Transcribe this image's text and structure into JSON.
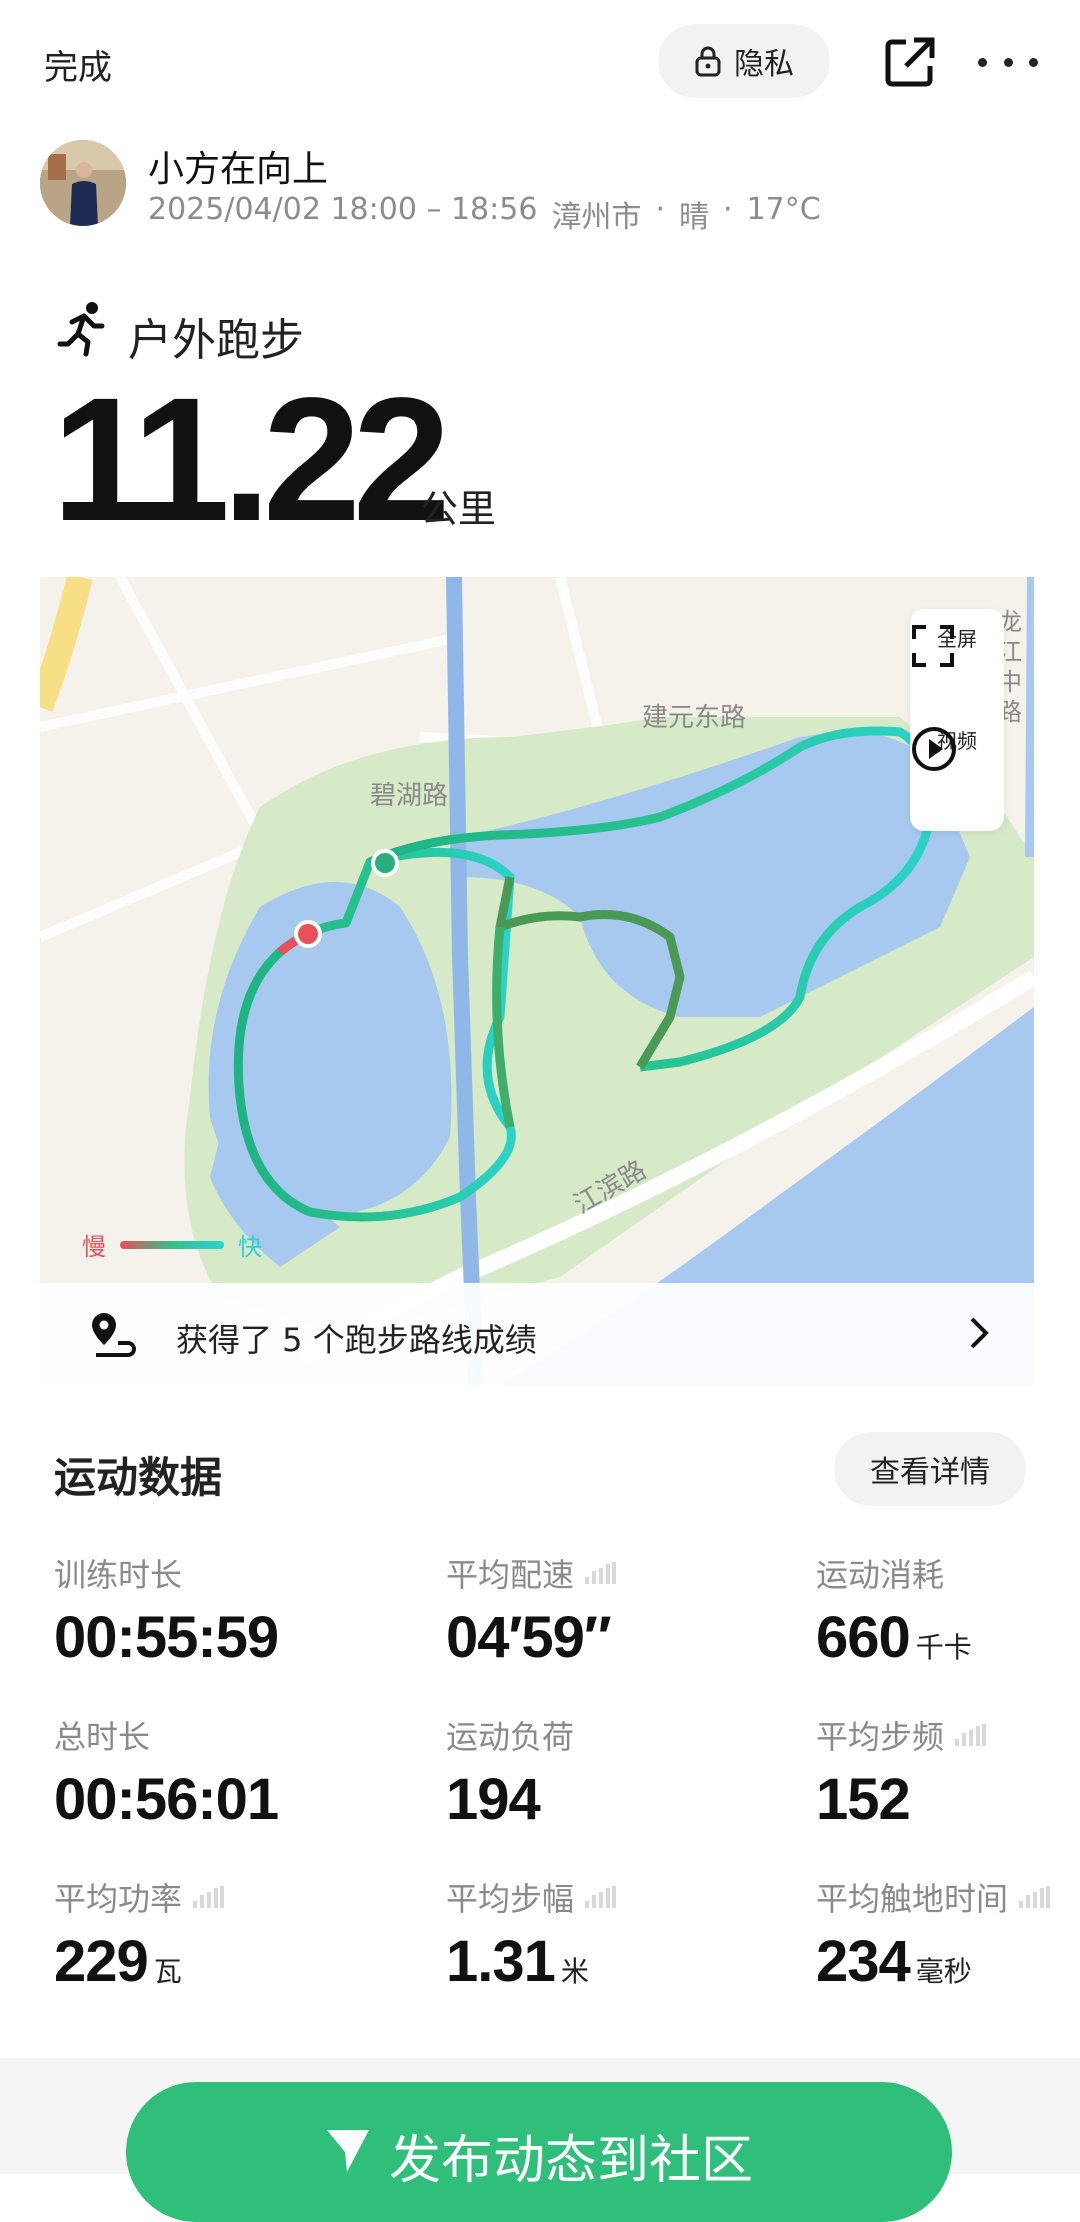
{
  "topbar": {
    "done": "完成",
    "privacy": "隐私"
  },
  "user": {
    "name": "小方在向上",
    "time": "2025/04/02 18:00 – 18:56",
    "city": "漳州市",
    "sep1": "·",
    "weather": "晴",
    "sep2": "·",
    "temperature": "17°C"
  },
  "activity": {
    "type": "户外跑步",
    "distance": "11.22",
    "unit": "公里"
  },
  "map": {
    "fullscreen": "全屏",
    "video": "视频",
    "roads": {
      "jianyuan": "建元东路",
      "bihu": "碧湖路",
      "jiangbin": "江滨路",
      "longjiang": [
        "龙",
        "江",
        "中",
        "路"
      ]
    },
    "legend": {
      "slow": "慢",
      "fast": "快",
      "slow_color": "#e9505a",
      "fast_color": "#2bd3d3"
    },
    "route_achievement": "获得了 5 个跑步路线成绩"
  },
  "stats": {
    "title": "运动数据",
    "detail": "查看详情",
    "items": [
      {
        "label": "训练时长",
        "value": "00:55:59",
        "unit": ""
      },
      {
        "label": "平均配速",
        "value": "04′59″",
        "unit": ""
      },
      {
        "label": "运动消耗",
        "value": "660",
        "unit": "千卡"
      },
      {
        "label": "总时长",
        "value": "00:56:01",
        "unit": ""
      },
      {
        "label": "运动负荷",
        "value": "194",
        "unit": ""
      },
      {
        "label": "平均步频",
        "value": "152",
        "unit": ""
      },
      {
        "label": "平均功率",
        "value": "229",
        "unit": "瓦"
      },
      {
        "label": "平均步幅",
        "value": "1.31",
        "unit": "米"
      },
      {
        "label": "平均触地时间",
        "value": "234",
        "unit": "毫秒"
      }
    ]
  },
  "publish": {
    "label": "发布动态到社区",
    "color": "#2fbf7a"
  }
}
